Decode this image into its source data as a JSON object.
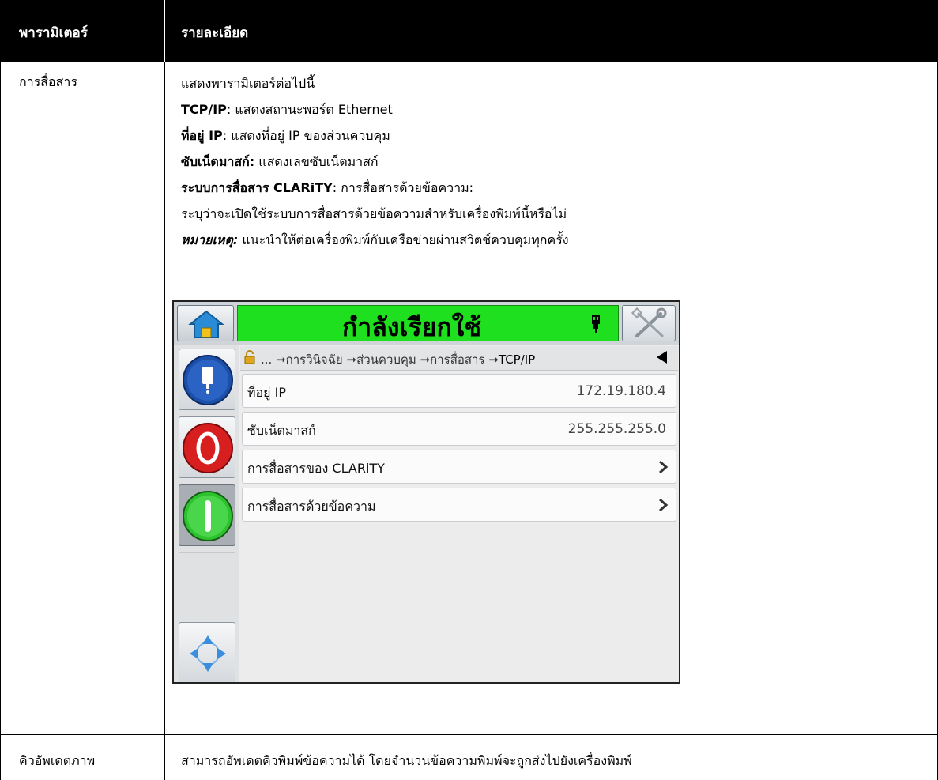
{
  "table": {
    "headers": [
      "พารามิเตอร์",
      "รายละเอียด"
    ],
    "rows": [
      {
        "param": "การสื่อสาร",
        "intro": "แสดงพารามิเตอร์ต่อไปนี้",
        "lines": [
          {
            "bold": "TCP/IP",
            "text": ": แสดงสถานะพอร์ต Ethernet"
          },
          {
            "bold": "ที่อยู่ IP",
            "text": ": แสดงที่อยู่ IP ของส่วนควบคุม"
          },
          {
            "bold": "ซับเน็ตมาสก์:",
            "text": " แสดงเลขซับเน็ตมาสก์"
          },
          {
            "bold": "ระบบการสื่อสาร CLARiTY",
            "text": ": การสื่อสารด้วยข้อความ:"
          }
        ],
        "extra": "ระบุว่าจะเปิดใช้ระบบการสื่อสารด้วยข้อความสำหรับเครื่องพิมพ์นี้หรือไม่",
        "note_label": "หมายเหตุ:",
        "note_text": " แนะนำให้ต่อเครื่องพิมพ์กับเครือข่ายผ่านสวิตช์ควบคุมทุกครั้ง"
      },
      {
        "param": "คิวอัพเดตภาพ",
        "desc": "สามารถอัพเดตคิวพิมพ์ข้อความได้ โดยจำนวนข้อความพิมพ์จะถูกส่งไปยังเครื่องพิมพ์"
      }
    ]
  },
  "screen": {
    "status": "กำลังเรียกใช้",
    "status_color": "#1ee01e",
    "breadcrumb": {
      "prefix": "...",
      "items": [
        "การวินิจฉัย",
        "ส่วนควบคุม",
        "การสื่อสาร"
      ],
      "current": "TCP/IP"
    },
    "list": [
      {
        "label": "ที่อยู่ IP",
        "value": "172.19.180.4"
      },
      {
        "label": "ซับเน็ตมาสก์",
        "value": "255.255.255.0"
      },
      {
        "label": "การสื่อสารของ CLARiTY",
        "chevron": true
      },
      {
        "label": "การสื่อสารด้วยข้อความ",
        "chevron": true
      }
    ],
    "icons": [
      "home-icon",
      "wrench-screwdriver-icon",
      "plug-icon",
      "lock-icon",
      "back-arrow-icon",
      "ink-cartridge-icon",
      "stop-icon",
      "start-icon",
      "navigation-arrows-icon",
      "chevron-right-icon"
    ]
  }
}
